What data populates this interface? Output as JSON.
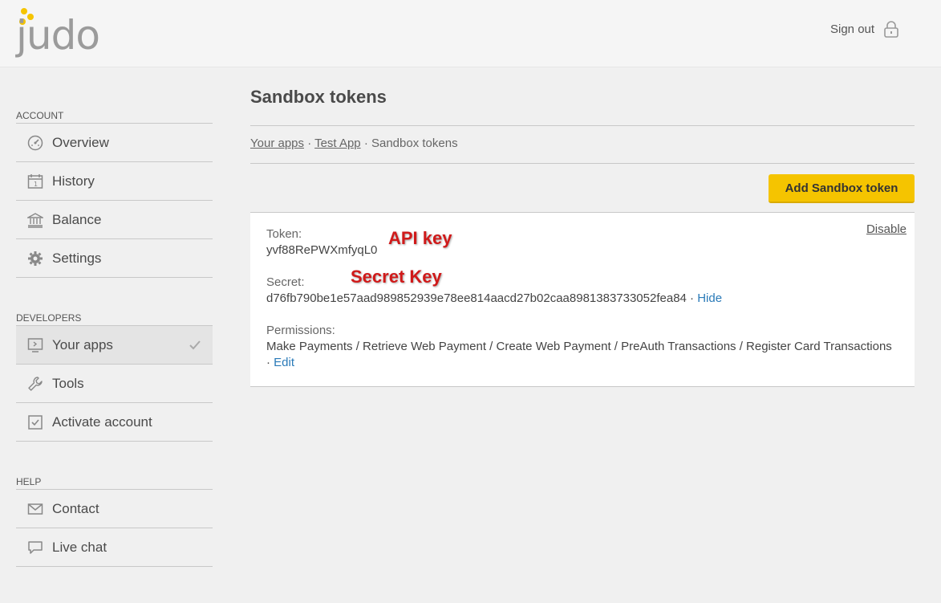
{
  "header": {
    "logo_text": "judo",
    "signout_label": "Sign out",
    "accent_color": "#f5c400"
  },
  "sidebar": {
    "sections": [
      {
        "title": "ACCOUNT",
        "items": [
          {
            "label": "Overview",
            "icon": "dashboard-gauge-icon"
          },
          {
            "label": "History",
            "icon": "calendar-icon"
          },
          {
            "label": "Balance",
            "icon": "bank-icon"
          },
          {
            "label": "Settings",
            "icon": "gear-icon"
          }
        ]
      },
      {
        "title": "DEVELOPERS",
        "items": [
          {
            "label": "Your apps",
            "icon": "monitor-icon",
            "active": true
          },
          {
            "label": "Tools",
            "icon": "wrench-icon"
          },
          {
            "label": "Activate account",
            "icon": "checkbox-icon"
          }
        ]
      },
      {
        "title": "HELP",
        "items": [
          {
            "label": "Contact",
            "icon": "envelope-icon"
          },
          {
            "label": "Live chat",
            "icon": "chat-bubble-icon"
          }
        ]
      }
    ]
  },
  "main": {
    "title": "Sandbox tokens",
    "breadcrumb": {
      "items": [
        "Your apps",
        "Test App"
      ],
      "current": "Sandbox tokens",
      "separator": "·"
    },
    "add_button_label": "Add Sandbox token",
    "token": {
      "token_label": "Token:",
      "token_value": "yvf88RePWXmfyqL0",
      "secret_label": "Secret:",
      "secret_value": "d76fb790be1e57aad989852939e78ee814aacd27b02caa8981383733052fea84",
      "hide_link": "Hide",
      "permissions_label": "Permissions:",
      "permissions_value": "Make Payments / Retrieve Web Payment / Create Web Payment / PreAuth Transactions / Register Card Transactions",
      "edit_link": "Edit",
      "disable_link": "Disable",
      "link_sep": "·"
    }
  },
  "annotations": {
    "api_key": "API key",
    "secret_key": "Secret Key"
  }
}
